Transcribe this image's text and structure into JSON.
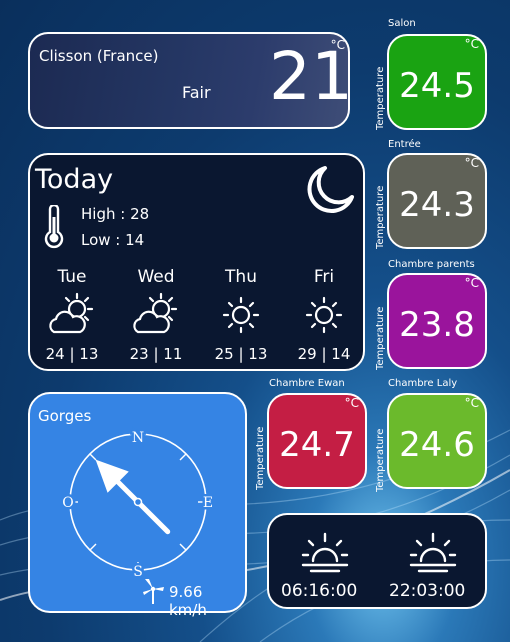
{
  "weather": {
    "location": "Clisson (France)",
    "condition": "Fair",
    "temperature": "21",
    "unit": "°C"
  },
  "today": {
    "title": "Today",
    "high": "High : 28",
    "low": "Low : 14",
    "forecast": [
      {
        "day": "Tue",
        "range": "24 | 13",
        "icon": "partly-cloudy-icon"
      },
      {
        "day": "Wed",
        "range": "23 | 11",
        "icon": "partly-cloudy-icon"
      },
      {
        "day": "Thu",
        "range": "25 | 13",
        "icon": "sun-icon"
      },
      {
        "day": "Fri",
        "range": "29 | 14",
        "icon": "sun-icon"
      }
    ]
  },
  "sensors": [
    {
      "room": "Salon",
      "value": "24.5",
      "unit": "°C",
      "axis": "Temperature",
      "color": "#1aa312"
    },
    {
      "room": "Entrée",
      "value": "24.3",
      "unit": "°C",
      "axis": "Temperature",
      "color": "#5f6157"
    },
    {
      "room": "Chambre parents",
      "value": "23.8",
      "unit": "°C",
      "axis": "Temperature",
      "color": "#9a149c"
    },
    {
      "room": "Chambre Ewan",
      "value": "24.7",
      "unit": "°C",
      "axis": "Temperature",
      "color": "#c41e44"
    },
    {
      "room": "Chambre Laly",
      "value": "24.6",
      "unit": "°C",
      "axis": "Temperature",
      "color": "#6bba2c"
    }
  ],
  "compass": {
    "location": "Gorges",
    "north": "N",
    "south": "S",
    "east": "E",
    "west": "O",
    "wind_speed": "9.66 km/h",
    "wind_direction_deg": 315
  },
  "sun": {
    "sunrise": "06:16:00",
    "sunset": "22:03:00"
  }
}
